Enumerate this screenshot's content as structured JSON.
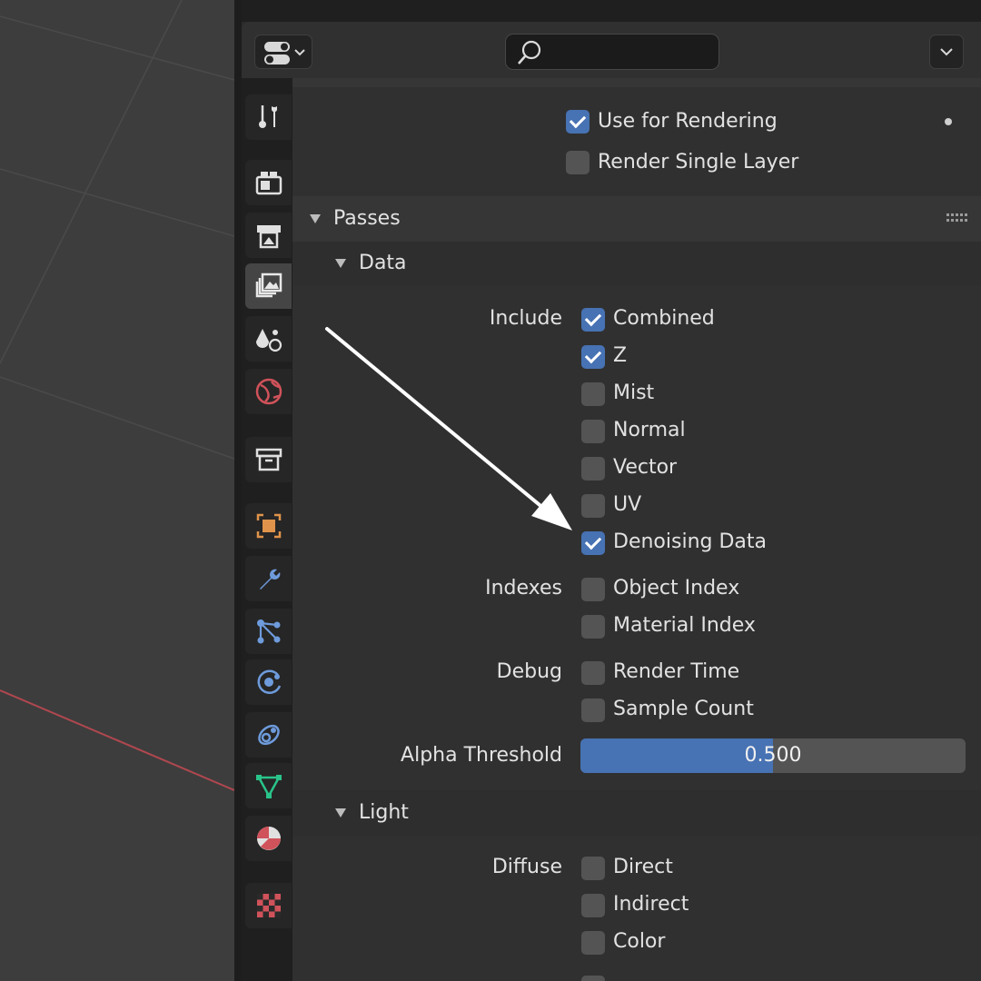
{
  "search": {
    "placeholder": ""
  },
  "layer_usage": {
    "use_for_rendering": {
      "label": "Use for Rendering",
      "checked": true
    },
    "render_single_layer": {
      "label": "Render Single Layer",
      "checked": false
    }
  },
  "passes": {
    "title": "Passes",
    "data": {
      "title": "Data",
      "include_label": "Include",
      "include_items": [
        {
          "label": "Combined",
          "checked": true
        },
        {
          "label": "Z",
          "checked": true
        },
        {
          "label": "Mist",
          "checked": false
        },
        {
          "label": "Normal",
          "checked": false
        },
        {
          "label": "Vector",
          "checked": false
        },
        {
          "label": "UV",
          "checked": false
        },
        {
          "label": "Denoising Data",
          "checked": true
        }
      ],
      "indexes_label": "Indexes",
      "indexes_items": [
        {
          "label": "Object Index",
          "checked": false
        },
        {
          "label": "Material Index",
          "checked": false
        }
      ],
      "debug_label": "Debug",
      "debug_items": [
        {
          "label": "Render Time",
          "checked": false
        },
        {
          "label": "Sample Count",
          "checked": false
        }
      ],
      "alpha_threshold": {
        "label": "Alpha Threshold",
        "value": "0.500",
        "fraction": 0.5
      }
    },
    "light": {
      "title": "Light",
      "diffuse_label": "Diffuse",
      "diffuse_items": [
        {
          "label": "Direct",
          "checked": false
        },
        {
          "label": "Indirect",
          "checked": false
        },
        {
          "label": "Color",
          "checked": false
        }
      ]
    }
  },
  "tabs": [
    {
      "icon": "tool-icon",
      "active": false
    },
    {
      "icon": "render-icon",
      "active": false
    },
    {
      "icon": "output-icon",
      "active": false
    },
    {
      "icon": "view-layer-icon",
      "active": true
    },
    {
      "icon": "scene-icon",
      "active": false
    },
    {
      "icon": "world-icon",
      "active": false
    },
    {
      "icon": "collection-icon",
      "active": false
    },
    {
      "icon": "object-icon",
      "active": false
    },
    {
      "icon": "modifier-icon",
      "active": false
    },
    {
      "icon": "particles-icon",
      "active": false
    },
    {
      "icon": "physics-icon",
      "active": false
    },
    {
      "icon": "constraints-icon",
      "active": false
    },
    {
      "icon": "object-data-icon",
      "active": false
    },
    {
      "icon": "material-icon",
      "active": false
    },
    {
      "icon": "texture-icon",
      "active": false
    }
  ],
  "colors": {
    "accent": "#4772b3",
    "panel": "#303030",
    "checkbox_off": "#545454"
  }
}
